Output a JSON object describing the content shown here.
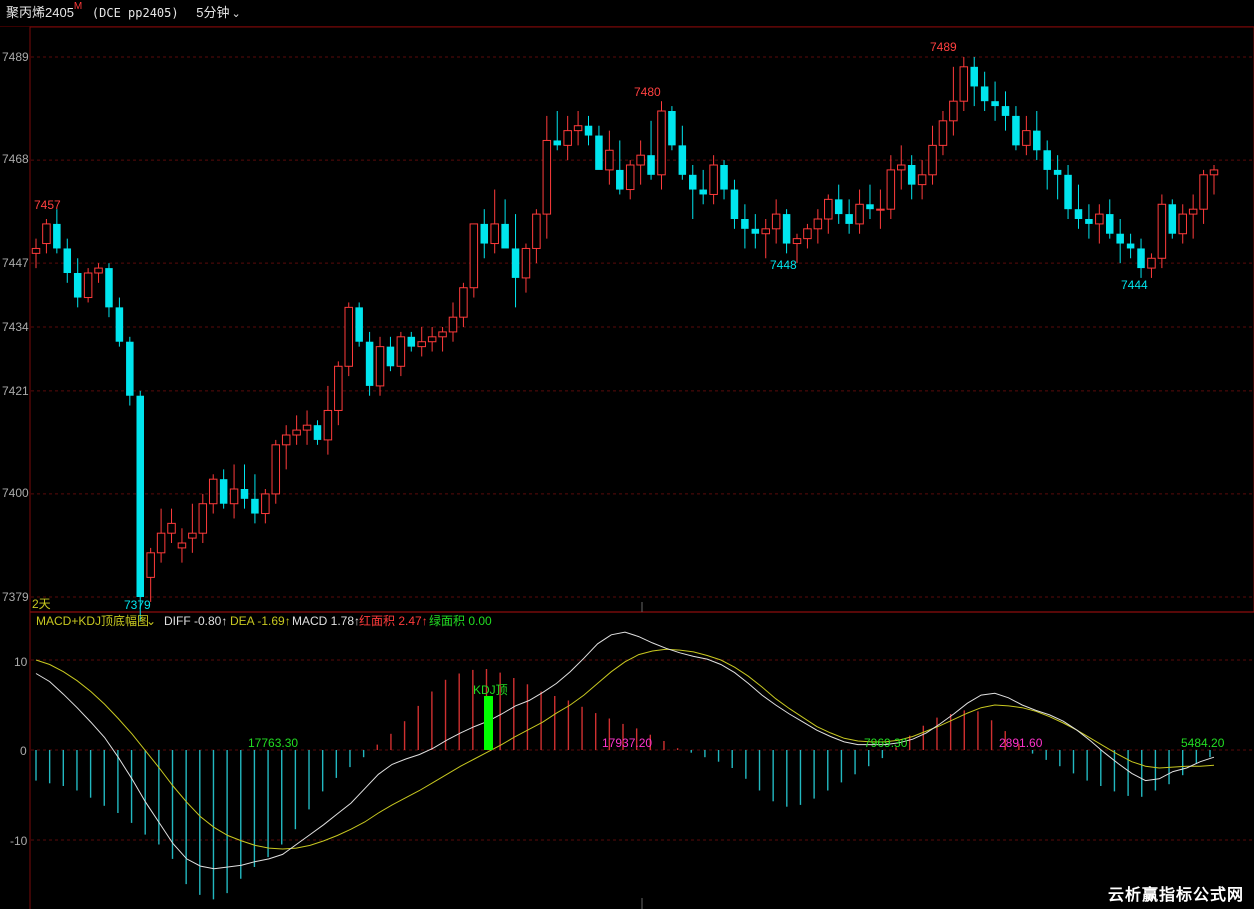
{
  "header": {
    "symbol": "聚丙烯2405",
    "symbol_badge": "M",
    "code": "(DCE pp2405)",
    "period": "5分钟",
    "dropdown_icon": "chevron-down-icon"
  },
  "colors": {
    "up": "#ff3b3b",
    "down": "#00e5ee",
    "grid": "#5a0a0a",
    "diff": "#e0e0e0",
    "dea": "#c8c820",
    "kdj_bar": "#00ff00",
    "label_green": "#22dd22",
    "label_magenta": "#ff33cc"
  },
  "price_panel": {
    "y_ticks": [
      "7489",
      "7468",
      "7447",
      "7434",
      "7421",
      "7400",
      "7379"
    ],
    "annotations": [
      "7457",
      "7379",
      "7480",
      "7489",
      "7448",
      "7444"
    ],
    "day_label": "2天"
  },
  "indicator_panel": {
    "title": "MACD+KDJ顶底幅图",
    "diff_label": "DIFF -0.80↑",
    "dea_label": "DEA -1.69↑",
    "macd_label": "MACD 1.78↑",
    "red_area_label": "红面积 2.47↑",
    "green_area_label": "绿面积 0.00",
    "y_ticks": [
      "10",
      "0",
      "-10"
    ],
    "area_labels": [
      "17763.30",
      "17937.20",
      "7969.30",
      "2891.60",
      "5484.20"
    ],
    "kdj_label": "KDJ顶"
  },
  "watermark": "云析赢指标公式网",
  "chart_data": [
    {
      "type": "candlestick",
      "title": "聚丙烯2405 5分钟",
      "ylim": [
        7379,
        7489
      ],
      "candles": [
        [
          7449,
          7452,
          7446,
          7450
        ],
        [
          7451,
          7456,
          7449,
          7455
        ],
        [
          7455,
          7458,
          7449,
          7450
        ],
        [
          7450,
          7452,
          7443,
          7445
        ],
        [
          7445,
          7448,
          7438,
          7440
        ],
        [
          7440,
          7446,
          7439,
          7445
        ],
        [
          7445,
          7447,
          7443,
          7446
        ],
        [
          7446,
          7447,
          7436,
          7438
        ],
        [
          7438,
          7440,
          7430,
          7431
        ],
        [
          7431,
          7432,
          7418,
          7420
        ],
        [
          7420,
          7421,
          7374,
          7379
        ],
        [
          7383,
          7389,
          7378,
          7388
        ],
        [
          7388,
          7397,
          7386,
          7392
        ],
        [
          7392,
          7397,
          7390,
          7394
        ],
        [
          7389,
          7393,
          7386,
          7390
        ],
        [
          7391,
          7398,
          7388,
          7392
        ],
        [
          7392,
          7400,
          7390,
          7398
        ],
        [
          7398,
          7404,
          7396,
          7403
        ],
        [
          7403,
          7405,
          7397,
          7398
        ],
        [
          7398,
          7406,
          7395,
          7401
        ],
        [
          7401,
          7406,
          7397,
          7399
        ],
        [
          7399,
          7404,
          7394,
          7396
        ],
        [
          7396,
          7401,
          7394,
          7400
        ],
        [
          7400,
          7411,
          7398,
          7410
        ],
        [
          7410,
          7414,
          7405,
          7412
        ],
        [
          7412,
          7416,
          7410,
          7413
        ],
        [
          7413,
          7417,
          7410,
          7414
        ],
        [
          7414,
          7415,
          7410,
          7411
        ],
        [
          7411,
          7422,
          7408,
          7417
        ],
        [
          7417,
          7427,
          7414,
          7426
        ],
        [
          7426,
          7439,
          7424,
          7438
        ],
        [
          7438,
          7439,
          7430,
          7431
        ],
        [
          7431,
          7433,
          7420,
          7422
        ],
        [
          7422,
          7432,
          7420,
          7430
        ],
        [
          7430,
          7432,
          7425,
          7426
        ],
        [
          7426,
          7433,
          7424,
          7432
        ],
        [
          7432,
          7433,
          7429,
          7430
        ],
        [
          7430,
          7434,
          7428,
          7431
        ],
        [
          7431,
          7434,
          7429,
          7432
        ],
        [
          7432,
          7434,
          7429,
          7433
        ],
        [
          7433,
          7439,
          7431,
          7436
        ],
        [
          7436,
          7443,
          7434,
          7442
        ],
        [
          7442,
          7452,
          7440,
          7455
        ],
        [
          7455,
          7458,
          7448,
          7451
        ],
        [
          7451,
          7462,
          7449,
          7455
        ],
        [
          7455,
          7460,
          7451,
          7450
        ],
        [
          7450,
          7457,
          7438,
          7444
        ],
        [
          7444,
          7451,
          7441,
          7450
        ],
        [
          7450,
          7458,
          7447,
          7457
        ],
        [
          7457,
          7477,
          7452,
          7472
        ],
        [
          7472,
          7478,
          7470,
          7471
        ],
        [
          7471,
          7477,
          7468,
          7474
        ],
        [
          7474,
          7478,
          7471,
          7475
        ],
        [
          7475,
          7477,
          7471,
          7473
        ],
        [
          7473,
          7475,
          7468,
          7466
        ],
        [
          7466,
          7474,
          7463,
          7470
        ],
        [
          7466,
          7472,
          7461,
          7462
        ],
        [
          7462,
          7468,
          7460,
          7467
        ],
        [
          7467,
          7472,
          7463,
          7469
        ],
        [
          7469,
          7476,
          7464,
          7465
        ],
        [
          7465,
          7480,
          7462,
          7478
        ],
        [
          7478,
          7479,
          7470,
          7471
        ],
        [
          7471,
          7475,
          7464,
          7465
        ],
        [
          7465,
          7467,
          7456,
          7462
        ],
        [
          7462,
          7466,
          7459,
          7461
        ],
        [
          7461,
          7469,
          7459,
          7467
        ],
        [
          7467,
          7468,
          7460,
          7462
        ],
        [
          7462,
          7464,
          7454,
          7456
        ],
        [
          7456,
          7459,
          7450,
          7454
        ],
        [
          7454,
          7457,
          7450,
          7453
        ],
        [
          7453,
          7456,
          7448,
          7454
        ],
        [
          7454,
          7460,
          7451,
          7457
        ],
        [
          7457,
          7458,
          7449,
          7451
        ],
        [
          7451,
          7453,
          7447,
          7452
        ],
        [
          7452,
          7455,
          7450,
          7454
        ],
        [
          7454,
          7458,
          7451,
          7456
        ],
        [
          7456,
          7461,
          7453,
          7460
        ],
        [
          7460,
          7463,
          7455,
          7457
        ],
        [
          7457,
          7460,
          7453,
          7455
        ],
        [
          7455,
          7462,
          7453,
          7459
        ],
        [
          7459,
          7463,
          7456,
          7458
        ],
        [
          7458,
          7462,
          7454,
          7458
        ],
        [
          7458,
          7469,
          7456,
          7466
        ],
        [
          7466,
          7471,
          7462,
          7467
        ],
        [
          7467,
          7469,
          7460,
          7463
        ],
        [
          7463,
          7468,
          7460,
          7465
        ],
        [
          7465,
          7475,
          7463,
          7471
        ],
        [
          7471,
          7478,
          7469,
          7476
        ],
        [
          7476,
          7487,
          7473,
          7480
        ],
        [
          7480,
          7489,
          7478,
          7487
        ],
        [
          7487,
          7489,
          7479,
          7483
        ],
        [
          7483,
          7486,
          7478,
          7480
        ],
        [
          7480,
          7484,
          7476,
          7479
        ],
        [
          7479,
          7482,
          7474,
          7477
        ],
        [
          7477,
          7479,
          7470,
          7471
        ],
        [
          7471,
          7477,
          7469,
          7474
        ],
        [
          7474,
          7478,
          7468,
          7470
        ],
        [
          7470,
          7472,
          7462,
          7466
        ],
        [
          7466,
          7469,
          7460,
          7465
        ],
        [
          7465,
          7467,
          7456,
          7458
        ],
        [
          7458,
          7463,
          7454,
          7456
        ],
        [
          7456,
          7459,
          7452,
          7455
        ],
        [
          7455,
          7459,
          7451,
          7457
        ],
        [
          7457,
          7460,
          7452,
          7453
        ],
        [
          7453,
          7456,
          7447,
          7451
        ],
        [
          7451,
          7453,
          7448,
          7450
        ],
        [
          7450,
          7452,
          7444,
          7446
        ],
        [
          7446,
          7449,
          7444,
          7448
        ],
        [
          7448,
          7461,
          7446,
          7459
        ],
        [
          7459,
          7460,
          7452,
          7453
        ],
        [
          7453,
          7459,
          7451,
          7457
        ],
        [
          7457,
          7461,
          7452,
          7458
        ],
        [
          7458,
          7466,
          7455,
          7465
        ],
        [
          7465,
          7467,
          7461,
          7466
        ]
      ]
    },
    {
      "type": "bar",
      "title": "MACD+KDJ顶底幅图",
      "ylim": [
        -15,
        12
      ],
      "series": [
        {
          "name": "DIFF",
          "values": [
            8.5,
            7.6,
            6.2,
            4.7,
            3.1,
            1.4,
            -0.8,
            -3.2,
            -5.8,
            -8.1,
            -10.4,
            -12.1,
            -12.9,
            -13.2,
            -13.0,
            -12.8,
            -12.4,
            -12.1,
            -11.6,
            -10.5,
            -9.4,
            -8.3,
            -7.1,
            -5.9,
            -4.3,
            -2.7,
            -1.6,
            -1.0,
            -0.5,
            0.2,
            1.1,
            1.9,
            2.6,
            3.2,
            4.0,
            4.9,
            5.5,
            6.4,
            7.4,
            8.7,
            10.2,
            11.8,
            12.8,
            13.1,
            12.6,
            11.9,
            11.3,
            10.8,
            10.4,
            10.1,
            9.5,
            8.6,
            7.4,
            6.1,
            5.0,
            4.0,
            3.1,
            2.2,
            1.5,
            0.9,
            0.6,
            0.6,
            0.6,
            0.8,
            1.2,
            1.9,
            2.9,
            4.0,
            5.2,
            6.1,
            6.3,
            5.8,
            5.0,
            4.4,
            3.9,
            3.2,
            2.2,
            1.0,
            -0.3,
            -1.5,
            -2.6,
            -3.4,
            -3.2,
            -2.4,
            -2.0,
            -1.3,
            -0.8
          ]
        },
        {
          "name": "DEA",
          "values": [
            10.0,
            9.5,
            8.7,
            7.7,
            6.5,
            5.1,
            3.5,
            1.8,
            -0.1,
            -2.0,
            -4.0,
            -5.8,
            -7.4,
            -8.6,
            -9.5,
            -10.1,
            -10.6,
            -10.9,
            -11.0,
            -10.9,
            -10.6,
            -10.1,
            -9.5,
            -8.8,
            -8.0,
            -7.0,
            -6.1,
            -5.3,
            -4.5,
            -3.6,
            -2.7,
            -1.8,
            -1.0,
            -0.2,
            0.6,
            1.5,
            2.3,
            3.1,
            4.1,
            5.0,
            6.1,
            7.4,
            8.7,
            9.8,
            10.6,
            11.0,
            11.2,
            11.1,
            10.9,
            10.5,
            10.0,
            9.2,
            8.2,
            7.0,
            5.7,
            4.6,
            3.6,
            2.6,
            1.9,
            1.3,
            1.0,
            0.9,
            0.9,
            1.1,
            1.5,
            2.1,
            2.7,
            3.4,
            4.1,
            4.7,
            5.0,
            4.9,
            4.7,
            4.3,
            3.7,
            3.0,
            2.2,
            1.3,
            0.4,
            -0.5,
            -1.3,
            -1.8,
            -2.0,
            -1.9,
            -1.8,
            -1.8,
            -1.7
          ]
        },
        {
          "name": "MACD",
          "values": [
            -3.4,
            -3.7,
            -4.0,
            -4.5,
            -5.3,
            -6.2,
            -7.0,
            -8.1,
            -9.4,
            -10.5,
            -12.1,
            -14.9,
            -16.1,
            -16.6,
            -15.9,
            -14.3,
            -13.0,
            -11.9,
            -10.5,
            -8.8,
            -6.6,
            -4.6,
            -3.1,
            -1.9,
            -0.8,
            0.6,
            1.8,
            3.2,
            4.9,
            6.5,
            7.8,
            8.5,
            8.9,
            9.0,
            8.6,
            8.0,
            7.3,
            6.5,
            6.0,
            5.5,
            4.8,
            4.1,
            3.5,
            2.9,
            2.4,
            1.7,
            1.0,
            0.2,
            -0.3,
            -0.8,
            -1.3,
            -2.0,
            -3.2,
            -4.5,
            -5.7,
            -6.3,
            -6.1,
            -5.4,
            -4.5,
            -3.6,
            -2.7,
            -1.8,
            -0.9,
            0.3,
            1.6,
            2.7,
            3.6,
            4.0,
            4.4,
            4.3,
            3.3,
            2.1,
            0.7,
            -0.4,
            -1.1,
            -1.8,
            -2.6,
            -3.4,
            -4.0,
            -4.6,
            -5.1,
            -5.2,
            -4.5,
            -3.8,
            -2.8,
            -1.5,
            -0.8
          ]
        }
      ]
    }
  ]
}
